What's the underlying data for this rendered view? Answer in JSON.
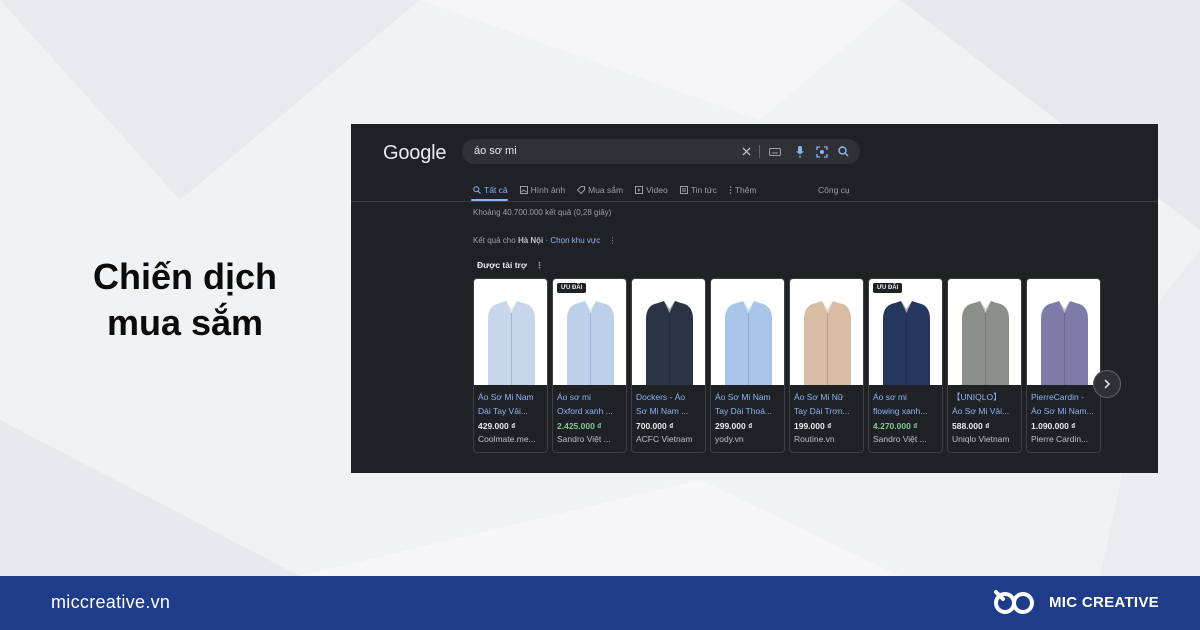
{
  "headline": {
    "line1": "Chiến dịch",
    "line2": "mua sắm"
  },
  "serp": {
    "logo": "Google",
    "search": {
      "query": "áo sơ mi"
    },
    "tabs": [
      {
        "label": "Tất cả",
        "icon": "search-icon",
        "active": true
      },
      {
        "label": "Hình ảnh",
        "icon": "image-icon",
        "active": false
      },
      {
        "label": "Mua sắm",
        "icon": "tag-icon",
        "active": false
      },
      {
        "label": "Video",
        "icon": "play-icon",
        "active": false
      },
      {
        "label": "Tin tức",
        "icon": "news-icon",
        "active": false
      },
      {
        "label": "Thêm",
        "icon": "more-icon",
        "active": false
      }
    ],
    "tools_label": "Công cụ",
    "stats": "Khoảng 40.700.000 kết quả (0,28 giây)",
    "location": {
      "prefix": "Kết quả cho",
      "city": "Hà Nội",
      "change": "Chọn khu vực"
    },
    "sponsored": "Được tài trợ",
    "products": [
      {
        "title1": "Áo Sơ Mi Nam",
        "title2": "Dài Tay Vải...",
        "price": "429.000 ₫",
        "merchant": "Coolmate.me...",
        "badge": "",
        "sale": false,
        "color": "#c7d6ea"
      },
      {
        "title1": "Áo sơ mi",
        "title2": "Oxford xanh ...",
        "price": "2.425.000 ₫",
        "merchant": "Sandro Việt ...",
        "badge": "ƯU ĐÃI",
        "sale": true,
        "color": "#bcd0ea"
      },
      {
        "title1": "Dockers - Áo",
        "title2": "Sơ Mi Nam ...",
        "price": "700.000 ₫",
        "merchant": "ACFC Vietnam",
        "badge": "",
        "sale": false,
        "color": "#2b3446"
      },
      {
        "title1": "Áo Sơ Mi Nam",
        "title2": "Tay Dài Thoá...",
        "price": "299.000 ₫",
        "merchant": "yody.vn",
        "badge": "",
        "sale": false,
        "color": "#a9c6ea"
      },
      {
        "title1": "Áo Sơ Mi Nữ",
        "title2": "Tay Dài Trơn...",
        "price": "199.000 ₫",
        "merchant": "Routine.vn",
        "badge": "",
        "sale": false,
        "color": "#d8bca4"
      },
      {
        "title1": "Áo sơ mi",
        "title2": "flowing xanh...",
        "price": "4.270.000 ₫",
        "merchant": "Sandro Việt ...",
        "badge": "ƯU ĐÃI",
        "sale": true,
        "color": "#26375e"
      },
      {
        "title1": "【UNIQLO】",
        "title2": "Áo Sơ Mi Vải...",
        "price": "588.000 ₫",
        "merchant": "Uniqlo Vietnam",
        "badge": "",
        "sale": false,
        "color": "#8a8f87"
      },
      {
        "title1": "PierreCardin -",
        "title2": "Áo Sơ Mi Nam...",
        "price": "1.090.000 ₫",
        "merchant": "Pierre Cardin...",
        "badge": "",
        "sale": false,
        "color": "#7d7ca8"
      }
    ]
  },
  "footer": {
    "site": "miccreative.vn",
    "brand": "MIC CREATIVE"
  },
  "colors": {
    "serp_bg": "#202124",
    "link": "#8ab4f8",
    "sale_price": "#81c995",
    "footer_bg": "#1f3c88"
  }
}
